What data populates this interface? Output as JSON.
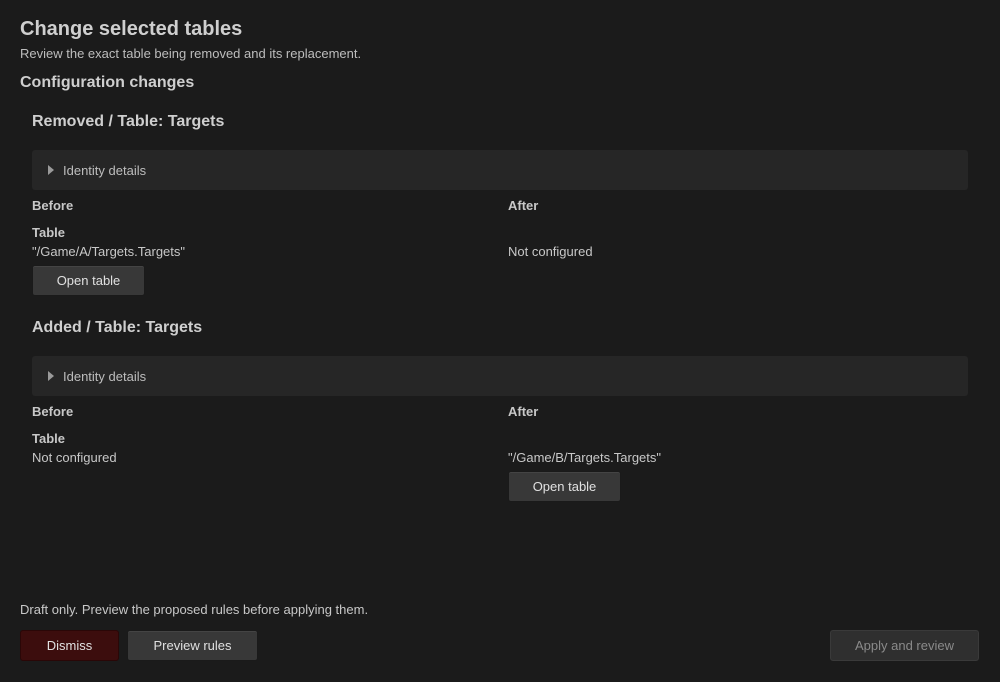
{
  "header": {
    "title": "Change selected tables",
    "subtitle": "Review the exact table being removed and its replacement.",
    "section_title": "Configuration changes"
  },
  "changes": [
    {
      "title": "Removed / Table: Targets",
      "identity_label": "Identity details",
      "before_label": "Before",
      "after_label": "After",
      "field_label": "Table",
      "before_value": "\"/Game/A/Targets.Targets\"",
      "after_value": "Not configured",
      "open_label": "Open table"
    },
    {
      "title": "Added / Table: Targets",
      "identity_label": "Identity details",
      "before_label": "Before",
      "after_label": "After",
      "field_label": "Table",
      "before_value": "Not configured",
      "after_value": "\"/Game/B/Targets.Targets\"",
      "open_label": "Open table"
    }
  ],
  "footer": {
    "note": "Draft only. Preview the proposed rules before applying them.",
    "dismiss_label": "Dismiss",
    "preview_label": "Preview rules",
    "apply_label": "Apply and review"
  }
}
